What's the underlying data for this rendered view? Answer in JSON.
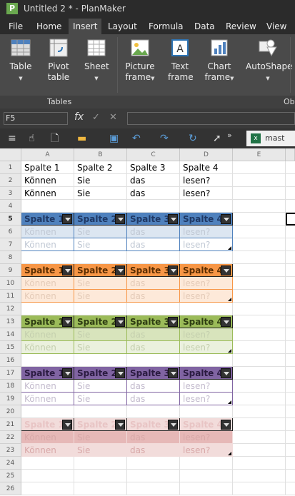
{
  "title": "Untitled 2 * - PlanMaker",
  "app_icon": "P",
  "menu": [
    "File",
    "Home",
    "Insert",
    "Layout",
    "Formula",
    "Data",
    "Review",
    "View"
  ],
  "ribbon": {
    "table": "Table",
    "pivot1": "Pivot",
    "pivot2": "table",
    "sheet": "Sheet",
    "pic1": "Picture",
    "pic2": "frame",
    "txt1": "Text",
    "txt2": "frame",
    "chart1": "Chart",
    "chart2": "frame",
    "auto": "AutoShape",
    "group_tables": "Tables",
    "group_obj": "Ob"
  },
  "namebox": "F5",
  "fx": "fx",
  "doc_tab": "mast",
  "columns": [
    "A",
    "B",
    "C",
    "D",
    "E"
  ],
  "rows": [
    "1",
    "2",
    "3",
    "4",
    "5",
    "6",
    "7",
    "8",
    "9",
    "10",
    "11",
    "12",
    "13",
    "14",
    "15",
    "16",
    "17",
    "18",
    "19",
    "20",
    "21",
    "22",
    "23",
    "24",
    "25",
    "26"
  ],
  "plain": [
    [
      "Spalte 1",
      "Spalte 2",
      "Spalte 3",
      "Spalte 4"
    ],
    [
      "Können",
      "Sie",
      "das",
      "lesen?"
    ],
    [
      "Können",
      "Sie",
      "das",
      "lesen?"
    ]
  ],
  "tables": [
    {
      "head": [
        "Spalte 1",
        "Spalte 2",
        "Spalte 3",
        "Spalte 4"
      ],
      "r1": [
        "Können",
        "Sie",
        "das",
        "lesen?"
      ],
      "r2": [
        "Können",
        "Sie",
        "das",
        "lesen?"
      ],
      "hbg": "#4f81bd",
      "hfg": "#1f3864",
      "b1": "#dce6f1",
      "b2": "#ffffff",
      "t": "#c0c8d4"
    },
    {
      "head": [
        "Spalte 1",
        "Spalte 2",
        "Spalte 3",
        "Spalte 4"
      ],
      "r1": [
        "Können",
        "Sie",
        "das",
        "lesen?"
      ],
      "r2": [
        "Können",
        "Sie",
        "das",
        "lesen?"
      ],
      "hbg": "#f79646",
      "hfg": "#5a2d00",
      "b1": "#fde9d9",
      "b2": "#fde9d9",
      "t": "#e4cbb8"
    },
    {
      "head": [
        "Spalte 1",
        "Spalte 2",
        "Spalte 3",
        "Spalte 4"
      ],
      "r1": [
        "Können",
        "Sie",
        "das",
        "lesen?"
      ],
      "r2": [
        "Können",
        "Sie",
        "das",
        "lesen?"
      ],
      "hbg": "#9bbb59",
      "hfg": "#2e3d12",
      "b1": "#d8e4bc",
      "b2": "#ebf1de",
      "t": "#c4cfae"
    },
    {
      "head": [
        "Spalte 1",
        "Spalte 2",
        "Spalte 3",
        "Spalte 4"
      ],
      "r1": [
        "Können",
        "Sie",
        "das",
        "lesen?"
      ],
      "r2": [
        "Können",
        "Sie",
        "das",
        "lesen?"
      ],
      "hbg": "#8064a2",
      "hfg": "#2a1a40",
      "b1": "#ffffff",
      "b2": "#ffffff",
      "t": "#c4bcce"
    },
    {
      "head": [
        "Spalte 1",
        "Spalte 2",
        "Spalte 3",
        "Spalte 4"
      ],
      "r1": [
        "Können",
        "Sie",
        "das",
        "lesen?"
      ],
      "r2": [
        "Können",
        "Sie",
        "das",
        "lesen?"
      ],
      "hbg": "#f2dcdb",
      "hfg": "#e8c4c4",
      "b1": "#e6b8b7",
      "b2": "#f2dcdb",
      "t": "#d8a8a8"
    }
  ]
}
